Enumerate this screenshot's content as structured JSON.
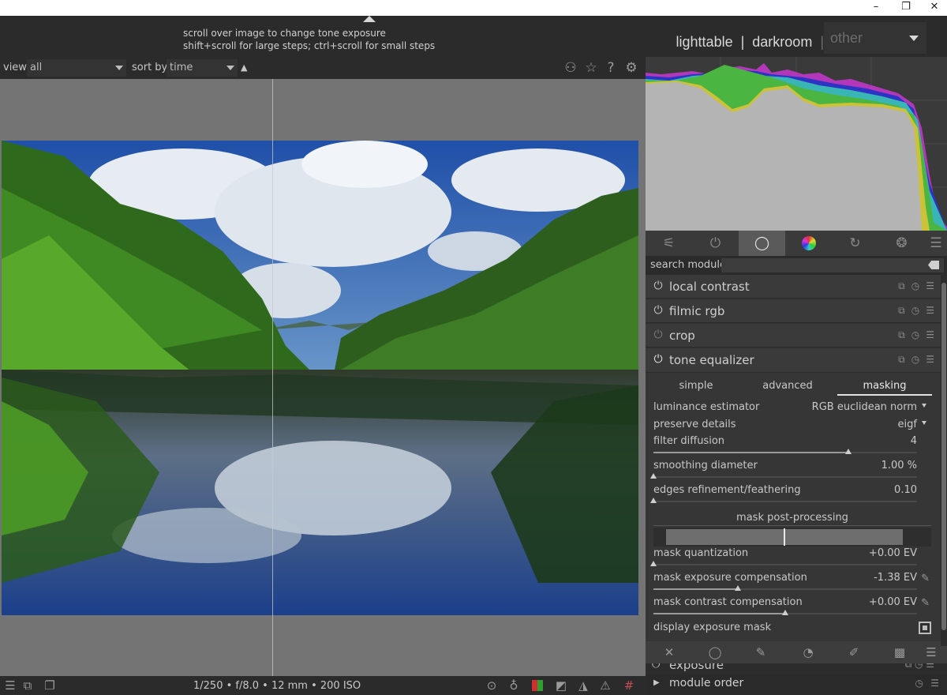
{
  "hint": {
    "line1": "scroll over image to change tone exposure",
    "line2": "shift+scroll for large steps; ctrl+scroll for small steps"
  },
  "views": {
    "lighttable": "lighttable",
    "sep1": "|",
    "darkroom": "darkroom",
    "sep2": "|",
    "other": "other"
  },
  "filter": {
    "view_label": "view",
    "view_value": "all",
    "sort_label": "sort by",
    "sort_value": "time",
    "sort_dir": "▲"
  },
  "exif": "1/250 • f/8.0 • 12 mm • 200 ISO",
  "search": {
    "label": "search module",
    "value": ""
  },
  "modules": [
    {
      "name": "local contrast",
      "enabled": true
    },
    {
      "name": "filmic rgb",
      "enabled": true
    },
    {
      "name": "crop",
      "enabled": false
    },
    {
      "name": "tone equalizer",
      "enabled": true,
      "expanded": true
    }
  ],
  "tone_equalizer": {
    "tabs": [
      "simple",
      "advanced",
      "masking"
    ],
    "active_tab": "masking",
    "luminance_estimator": {
      "label": "luminance estimator",
      "value": "RGB euclidean norm"
    },
    "preserve_details": {
      "label": "preserve details",
      "value": "eigf"
    },
    "filter_diffusion": {
      "label": "filter diffusion",
      "value": "4",
      "fraction": 0.74
    },
    "smoothing_diameter": {
      "label": "smoothing diameter",
      "value": "1.00 %",
      "fraction": 0.0
    },
    "edges_refinement": {
      "label": "edges refinement/feathering",
      "value": "0.10",
      "fraction": 0.0
    },
    "section_title": "mask post-processing",
    "mask_quantization": {
      "label": "mask quantization",
      "value": "+0.00 EV",
      "fraction": 0.0
    },
    "mask_exposure_comp": {
      "label": "mask exposure compensation",
      "value": "-1.38 EV",
      "fraction": 0.32
    },
    "mask_contrast_comp": {
      "label": "mask contrast compensation",
      "value": "+0.00 EV",
      "fraction": 0.5
    },
    "display_mask": {
      "label": "display exposure mask",
      "checked": false
    }
  },
  "next_module": {
    "name": "exposure"
  },
  "module_order": {
    "label": "module order"
  },
  "colors": {
    "accent": "#e0e0e0",
    "panel": "#303030",
    "histogram_bg": "#3a3a3a",
    "histogram_gray": "#b4b4b4",
    "histogram_yellow": "#cbc23a",
    "histogram_green": "#4ab541",
    "histogram_blue": "#2d34c4",
    "histogram_cyan": "#3ab5b5",
    "histogram_magenta": "#c038c8"
  }
}
